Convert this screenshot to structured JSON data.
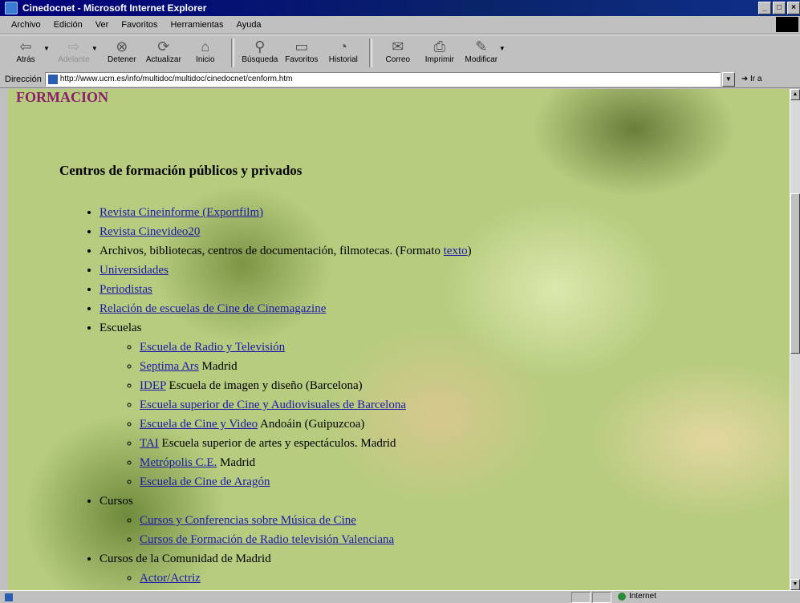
{
  "window": {
    "title": "Cinedocnet - Microsoft Internet Explorer",
    "controls": [
      "_",
      "□",
      "×"
    ]
  },
  "menu": [
    "Archivo",
    "Edición",
    "Ver",
    "Favoritos",
    "Herramientas",
    "Ayuda"
  ],
  "toolbar": {
    "back": "Atrás",
    "forward": "Adelante",
    "stop": "Detener",
    "refresh": "Actualizar",
    "home": "Inicio",
    "search": "Búsqueda",
    "favorites": "Favoritos",
    "history": "Historial",
    "mail": "Correo",
    "print": "Imprimir",
    "edit": "Modificar"
  },
  "address": {
    "label": "Dirección",
    "url": "http://www.ucm.es/info/multidoc/multidoc/cinedocnet/cenform.htm",
    "go": "Ir a"
  },
  "page": {
    "heading": "FORMACION",
    "subheading": "Centros de formación públicos y privados",
    "list": [
      {
        "link": "Revista Cineinforme (Exportfilm)"
      },
      {
        "link": "Revista Cinevideo20"
      },
      {
        "text": "Archivos, bibliotecas, centros de documentación, filmotecas. (Formato ",
        "link": "texto",
        "after": ")"
      },
      {
        "link": "Universidades"
      },
      {
        "link": "Periodistas"
      },
      {
        "link": "Relación de escuelas de Cine de Cinemagazine"
      },
      {
        "text": "Escuelas",
        "children": [
          {
            "link": "Escuela de Radio y Televisión"
          },
          {
            "link": "Septima Ars",
            "after": " Madrid"
          },
          {
            "link": "IDEP",
            "after": " Escuela de imagen y diseño (Barcelona)"
          },
          {
            "link": "Escuela superior de Cine y Audiovisuales de Barcelona"
          },
          {
            "link": "Escuela de Cine y Video",
            "after": " Andoáin (Guipuzcoa)"
          },
          {
            "link": "TAI",
            "after": " Escuela superior de artes y espectáculos. Madrid"
          },
          {
            "link": "Metrópolis C.E.",
            "after": " Madrid"
          },
          {
            "link": "Escuela de Cine de Aragón"
          }
        ]
      },
      {
        "text": "Cursos",
        "children": [
          {
            "link": "Cursos y Conferencias sobre Música de Cine"
          },
          {
            "link": "Cursos de Formación de Radio televisión Valenciana"
          }
        ]
      },
      {
        "text": "Cursos de la Comunidad de Madrid",
        "children": [
          {
            "link": "Actor/Actriz"
          }
        ]
      }
    ]
  },
  "status": {
    "zone": "Internet"
  }
}
